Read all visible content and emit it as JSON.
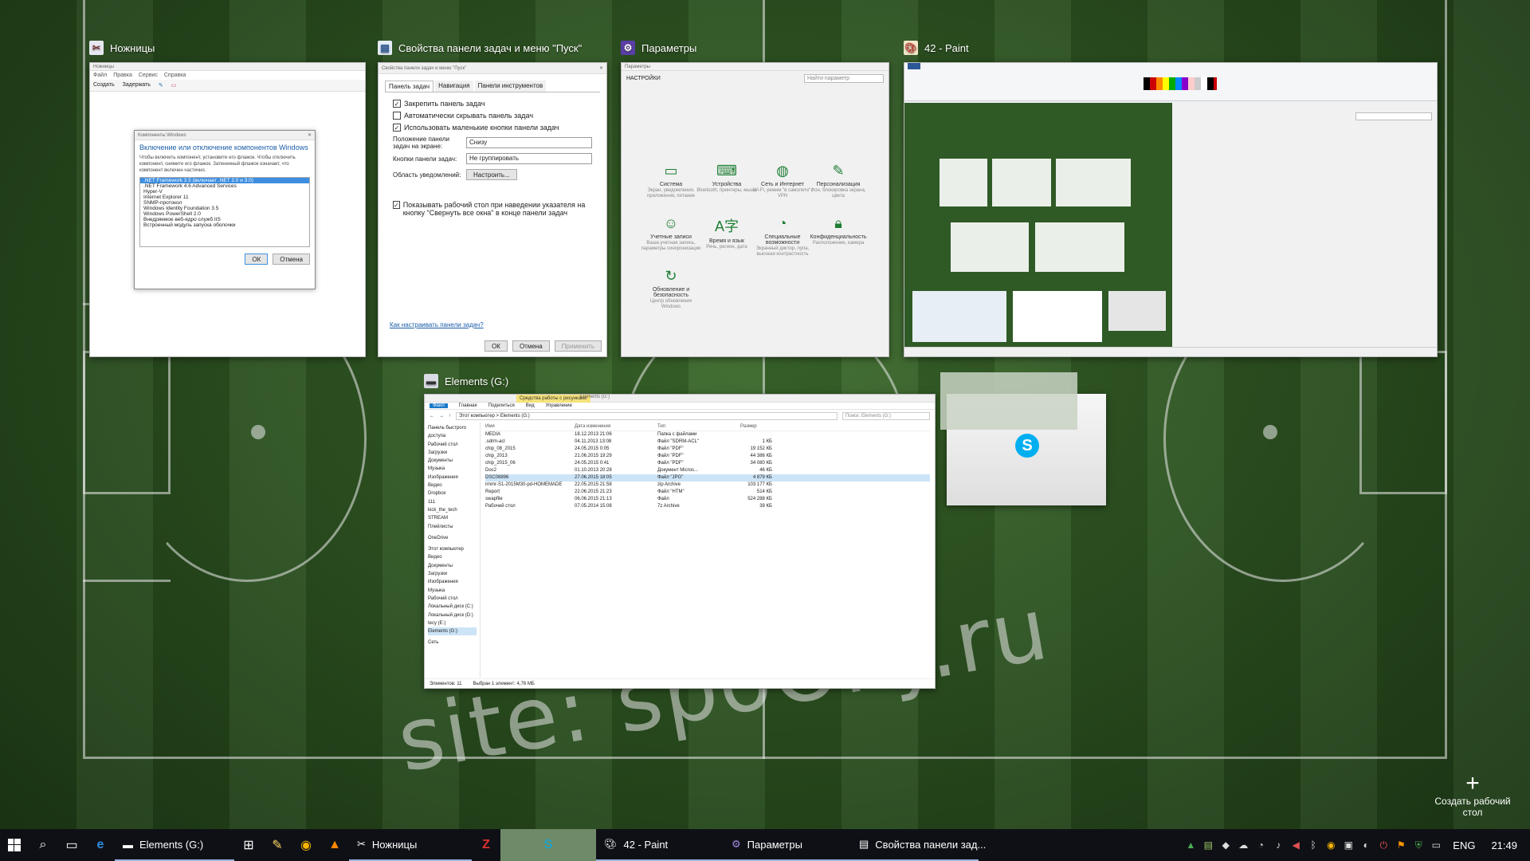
{
  "task_view": {
    "windows": [
      {
        "id": "snipping",
        "title": "Ножницы",
        "icon": "scissors-icon",
        "menu": [
          "Файл",
          "Правка",
          "Сервис",
          "Справка"
        ],
        "toolbar": [
          "Создать",
          "Задержать"
        ],
        "dialog": {
          "title": "Компоненты Windows",
          "heading": "Включение или отключение компонентов Windows",
          "description": "Чтобы включить компонент, установите его флажок. Чтобы отключить компонент, снимите его флажок. Затененный флажок означает, что компонент включен частично.",
          "items": [
            ".NET Framework 3.5 (включает .NET 2.0 и 3.0)",
            ".NET Framework 4.6 Advanced Services",
            "Hyper-V",
            "Internet Explorer 11",
            "SNMP-протокол",
            "Windows Identity Foundation 3.5",
            "Windows PowerShell 2.0",
            "Внедряемое веб-ядро служб IIS",
            "Встроенный модуль запуска оболочки"
          ],
          "ok": "ОК",
          "cancel": "Отмена"
        }
      },
      {
        "id": "taskbar-props",
        "title": "Свойства панели задач и меню \"Пуск\"",
        "icon": "taskbar-properties-icon",
        "tabs": [
          "Панель задач",
          "Навигация",
          "Панели инструментов"
        ],
        "options": [
          {
            "label": "Закрепить панель задач",
            "checked": true
          },
          {
            "label": "Автоматически скрывать панель задач",
            "checked": false
          },
          {
            "label": "Использовать маленькие кнопки панели задач",
            "checked": true
          }
        ],
        "position_label": "Положение панели задач на экране:",
        "position_value": "Снизу",
        "buttons_label": "Кнопки панели задач:",
        "buttons_value": "Не группировать",
        "notify_label": "Область уведомлений:",
        "notify_button": "Настроить...",
        "peek_label": "Показывать рабочий стол при наведении указателя на кнопку \"Свернуть все окна\" в конце панели задач",
        "help_link": "Как настраивать панели задач?",
        "ok": "ОК",
        "cancel": "Отмена",
        "apply": "Применить"
      },
      {
        "id": "settings",
        "title": "Параметры",
        "icon": "settings-gear-icon",
        "header": "НАСТРОЙКИ",
        "search_placeholder": "Найти параметр",
        "tiles": [
          {
            "name": "Система",
            "sub": "Экран, уведомления, приложения, питание",
            "icon": "laptop-icon"
          },
          {
            "name": "Устройства",
            "sub": "Bluetooth, принтеры, мышь",
            "icon": "devices-icon"
          },
          {
            "name": "Сеть и Интернет",
            "sub": "Wi-Fi, режим \"в самолете\", VPN",
            "icon": "globe-icon"
          },
          {
            "name": "Персонализация",
            "sub": "Фон, блокировка экрана, цвета",
            "icon": "brush-icon"
          },
          {
            "name": "Учетные записи",
            "sub": "Ваша учетная запись, параметры синхронизации",
            "icon": "user-icon"
          },
          {
            "name": "Время и язык",
            "sub": "Речь, регион, дата",
            "icon": "language-icon"
          },
          {
            "name": "Специальные возможности",
            "sub": "Экранный диктор, лупа, высокая контрастность",
            "icon": "accessibility-icon"
          },
          {
            "name": "Конфиденциальность",
            "sub": "Расположение, камера",
            "icon": "lock-icon"
          },
          {
            "name": "Обновление и безопасность",
            "sub": "Центр обновления Windows",
            "icon": "update-icon"
          }
        ]
      },
      {
        "id": "paint",
        "title": "42 - Paint",
        "icon": "paint-palette-icon"
      },
      {
        "id": "explorer",
        "title": "Elements (G:)",
        "icon": "drive-icon",
        "ribbon_tabs": [
          "Файл",
          "Главная",
          "Поделиться",
          "Вид"
        ],
        "ribbon_context": "Средства работы с рисунками",
        "ribbon_context_tab": "Управление",
        "address": "Этот компьютер > Elements (G:)",
        "search_placeholder": "Поиск: Elements (G:)",
        "columns": [
          "Имя",
          "Дата изменения",
          "Тип",
          "Размер"
        ],
        "nav": [
          "Панель быстрого доступа",
          "Рабочий стол",
          "Загрузки",
          "Документы",
          "Музыка",
          "Изображения",
          "Видео",
          "Dropbox",
          "111",
          "kick_the_tech",
          "STREAM",
          "Плейлисты",
          "OneDrive",
          "Этот компьютер",
          "Видео",
          "Документы",
          "Загрузки",
          "Изображения",
          "Музыка",
          "Рабочий стол",
          "Локальный диск (C:)",
          "Локальный диск (D:)",
          "tecy (E:)",
          "Elements (G:)",
          "Сеть"
        ],
        "files": [
          {
            "name": "MEDIA",
            "date": "18.12.2013 21:06",
            "type": "Папка с файлами",
            "size": ""
          },
          {
            "name": ".sdrm-acl",
            "date": "04.11.2013 13:08",
            "type": "Файл \"SDRM-ACL\"",
            "size": "1 КБ"
          },
          {
            "name": "chip_08_2015",
            "date": "24.05.2015 0:05",
            "type": "Файл \"PDF\"",
            "size": "19 152 КБ"
          },
          {
            "name": "chip_2013",
            "date": "21.06.2015 19:29",
            "type": "Файл \"PDF\"",
            "size": "44 386 КБ"
          },
          {
            "name": "chip_2015_06",
            "date": "24.05.2015 0:41",
            "type": "Файл \"PDF\"",
            "size": "34 080 КБ"
          },
          {
            "name": "Doc2",
            "date": "01.10.2013 20:28",
            "type": "Документ Micros...",
            "size": "46 КБ"
          },
          {
            "name": "DSC08896",
            "date": "27.06.2015 18:05",
            "type": "Файл \"JPG\"",
            "size": "4 879 КБ"
          },
          {
            "name": "rmmr-S1-2015M30-pd-HOMEMADE",
            "date": "22.05.2015 21:58",
            "type": "zip Archive",
            "size": "103 177 КБ"
          },
          {
            "name": "Report",
            "date": "22.06.2015 21:23",
            "type": "Файл \"HTM\"",
            "size": "514 КБ"
          },
          {
            "name": "swapfile",
            "date": "06.06.2015 21:13",
            "type": "Файл",
            "size": "524 288 КБ"
          },
          {
            "name": "Рабочий стол",
            "date": "07.05.2014 15:08",
            "type": "7z Archive",
            "size": "39 КБ"
          }
        ],
        "status_count": "Элементов: 11",
        "status_selected": "Выбран 1 элемент: 4,76 МБ"
      },
      {
        "id": "skype",
        "title": "",
        "icon": "skype-icon"
      }
    ],
    "watermark": "site: spoOky.ru",
    "new_desktop_label": "Создать рабочий стол"
  },
  "taskbar": {
    "apps": [
      {
        "label": "Elements (G:)",
        "icon": "drive-icon"
      },
      {
        "label": "",
        "icon": "store-icon"
      },
      {
        "label": "",
        "icon": "notepad-icon"
      },
      {
        "label": "",
        "icon": "chrome-icon"
      },
      {
        "label": "",
        "icon": "vlc-icon"
      },
      {
        "label": "Ножницы",
        "icon": "scissors-icon"
      },
      {
        "label": "",
        "icon": "filezilla-icon"
      },
      {
        "label": "",
        "icon": "skype-icon"
      },
      {
        "label": "42 - Paint",
        "icon": "paint-palette-icon"
      },
      {
        "label": "Параметры",
        "icon": "settings-gear-icon"
      },
      {
        "label": "Свойства панели зад...",
        "icon": "taskbar-properties-icon"
      }
    ],
    "language": "ENG",
    "time": "21:49"
  }
}
